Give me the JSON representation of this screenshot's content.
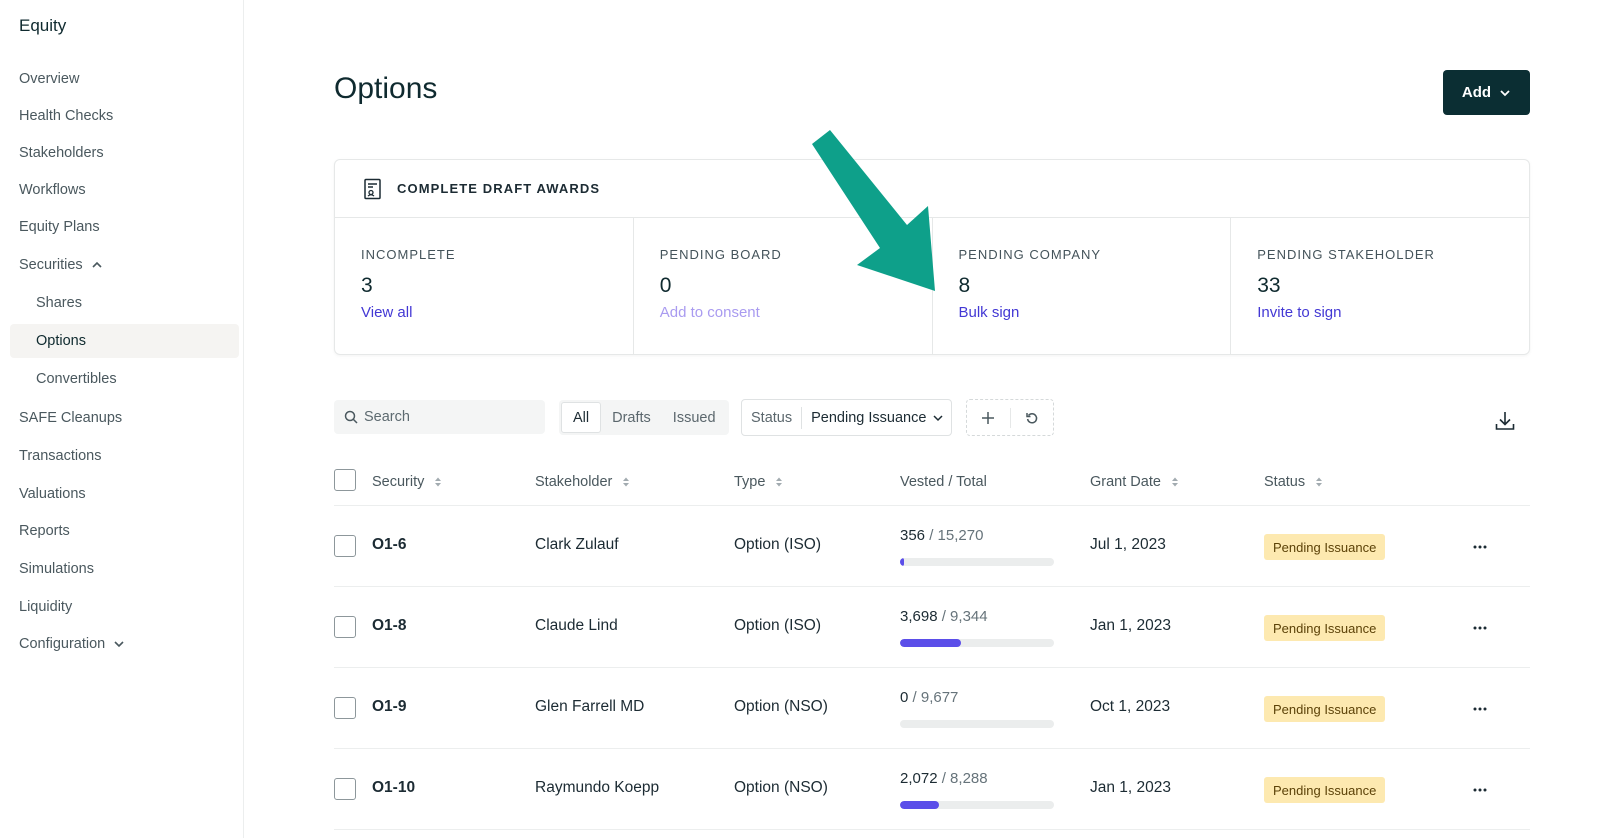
{
  "sidebar": {
    "title": "Equity",
    "items": [
      {
        "label": "Overview"
      },
      {
        "label": "Health Checks"
      },
      {
        "label": "Stakeholders"
      },
      {
        "label": "Workflows"
      },
      {
        "label": "Equity Plans"
      },
      {
        "label": "Securities"
      },
      {
        "label": "Shares"
      },
      {
        "label": "Options"
      },
      {
        "label": "Convertibles"
      },
      {
        "label": "SAFE Cleanups"
      },
      {
        "label": "Transactions"
      },
      {
        "label": "Valuations"
      },
      {
        "label": "Reports"
      },
      {
        "label": "Simulations"
      },
      {
        "label": "Liquidity"
      },
      {
        "label": "Configuration"
      }
    ]
  },
  "page": {
    "title": "Options",
    "add_label": "Add"
  },
  "draft_awards": {
    "title": "COMPLETE DRAFT AWARDS",
    "stats": [
      {
        "label": "INCOMPLETE",
        "value": "3",
        "link": "View all"
      },
      {
        "label": "PENDING BOARD",
        "value": "0",
        "link": "Add to consent"
      },
      {
        "label": "PENDING COMPANY",
        "value": "8",
        "link": "Bulk sign"
      },
      {
        "label": "PENDING STAKEHOLDER",
        "value": "33",
        "link": "Invite to sign"
      }
    ]
  },
  "toolbar": {
    "search_placeholder": "Search",
    "segments": [
      "All",
      "Drafts",
      "Issued"
    ],
    "status_key": "Status",
    "status_value": "Pending Issuance"
  },
  "table": {
    "columns": [
      "Security",
      "Stakeholder",
      "Type",
      "Vested / Total",
      "Grant Date",
      "Status"
    ],
    "rows": [
      {
        "security": "O1-6",
        "stakeholder": "Clark Zulauf",
        "type": "Option (ISO)",
        "vested": "356",
        "total": "/ 15,270",
        "vested_fraction": 0.023,
        "grant_date": "Jul 1, 2023",
        "status": "Pending Issuance"
      },
      {
        "security": "O1-8",
        "stakeholder": "Claude Lind",
        "type": "Option (ISO)",
        "vested": "3,698",
        "total": "/ 9,344",
        "vested_fraction": 0.396,
        "grant_date": "Jan 1, 2023",
        "status": "Pending Issuance"
      },
      {
        "security": "O1-9",
        "stakeholder": "Glen Farrell MD",
        "type": "Option (NSO)",
        "vested": "0",
        "total": "/ 9,677",
        "vested_fraction": 0,
        "grant_date": "Oct 1, 2023",
        "status": "Pending Issuance"
      },
      {
        "security": "O1-10",
        "stakeholder": "Raymundo Koepp",
        "type": "Option (NSO)",
        "vested": "2,072",
        "total": "/ 8,288",
        "vested_fraction": 0.25,
        "grant_date": "Jan 1, 2023",
        "status": "Pending Issuance"
      }
    ]
  },
  "colors": {
    "primary_dark": "#0b2e33",
    "link": "#4338d4",
    "progress": "#5b4ee9",
    "badge_bg": "#fde9b0",
    "arrow": "#0ea08a"
  },
  "icons": [
    "document-icon",
    "chevron-up-icon",
    "chevron-down-icon",
    "search-icon",
    "plus-icon",
    "reset-icon",
    "download-icon",
    "sort-icon",
    "more-icon",
    "arrow-annotation-icon"
  ]
}
